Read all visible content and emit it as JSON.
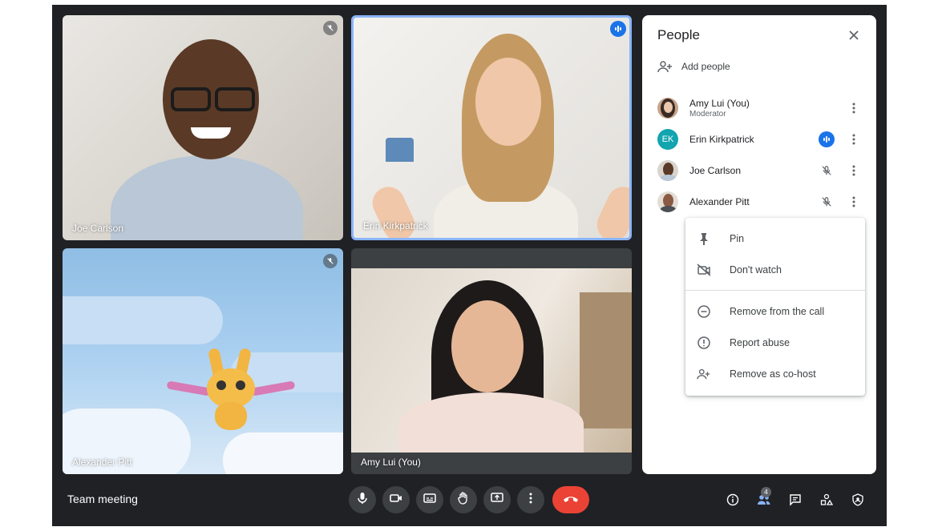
{
  "meeting": {
    "title": "Team meeting"
  },
  "tiles": [
    {
      "name": "Joe Carlson",
      "muted": true
    },
    {
      "name": "Erin Kirkpatrick",
      "speaking": true
    },
    {
      "name": "Alexander Pitt",
      "muted": true
    },
    {
      "name": "Amy Lui (You)"
    }
  ],
  "people_panel": {
    "title": "People",
    "add_people": "Add people",
    "participants": [
      {
        "name": "Amy Lui (You)",
        "role": "Moderator",
        "avatar": "photo"
      },
      {
        "name": "Erin Kirkpatrick",
        "initials": "EK",
        "avatar_color": "#12a4af",
        "status": "speaking"
      },
      {
        "name": "Joe Carlson",
        "avatar": "photo",
        "status": "muted"
      },
      {
        "name": "Alexander Pitt",
        "avatar": "photo",
        "status": "muted"
      }
    ]
  },
  "context_menu": {
    "items": [
      {
        "label": "Pin",
        "icon": "pin-icon"
      },
      {
        "label": "Don't watch",
        "icon": "video-off-icon"
      },
      {
        "label": "Remove from the call",
        "icon": "remove-circle-icon"
      },
      {
        "label": "Report abuse",
        "icon": "report-icon"
      },
      {
        "label": "Remove as co-host",
        "icon": "person-add-icon"
      }
    ]
  },
  "controls": {
    "icons": [
      "mic-icon",
      "camera-icon",
      "captions-icon",
      "raise-hand-icon",
      "present-icon",
      "more-vert-icon",
      "end-call-icon"
    ],
    "right_icons": [
      "info-icon",
      "people-icon",
      "chat-icon",
      "activities-icon",
      "host-controls-icon"
    ],
    "people_count": "4"
  },
  "colors": {
    "accent": "#1a73e8",
    "end_call": "#ea4335",
    "background": "#202124"
  }
}
